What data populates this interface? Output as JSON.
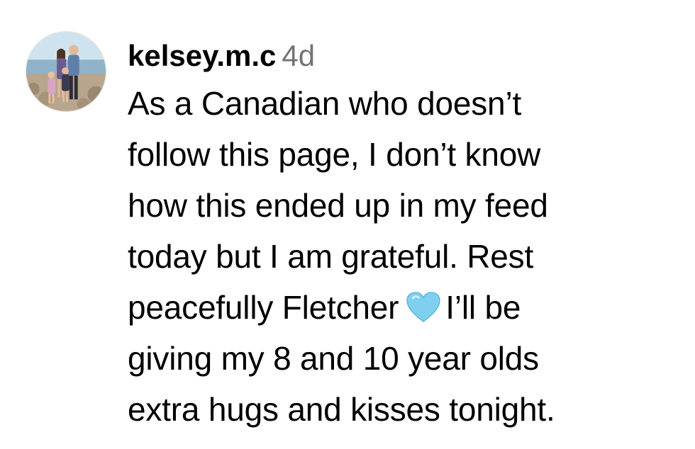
{
  "comment": {
    "username": "kelsey.m.c",
    "age": "4d",
    "avatar_icon": "family-photo-avatar",
    "lines": [
      "As a Canadian who doesn’t",
      "follow this page, I don’t know",
      "how this ended up in my feed",
      "today but I am grateful. Rest",
      "peacefully Fletcher",
      "I’ll be",
      "giving my 8 and 10 year olds",
      "extra hugs and kisses tonight."
    ],
    "emoji": "light-blue-heart-icon",
    "emoji_color": "#7fd0f0"
  }
}
